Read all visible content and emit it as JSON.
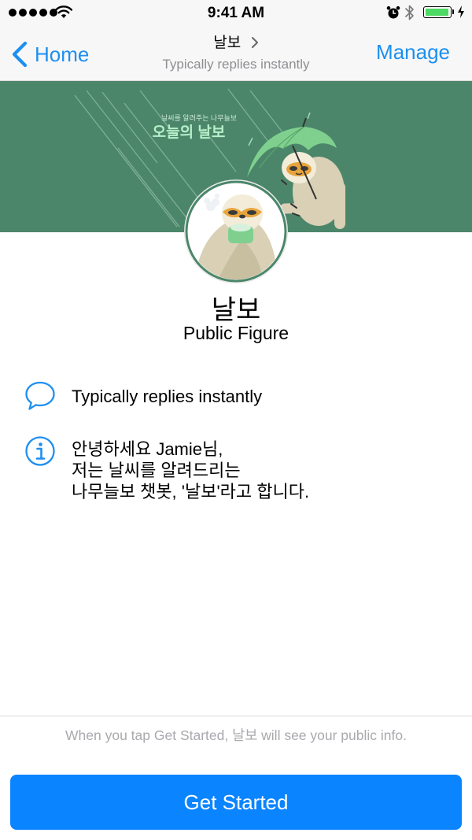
{
  "status_bar": {
    "time": "9:41 AM",
    "signal_icon": "signal-dots-icon",
    "wifi_icon": "wifi-icon",
    "alarm_icon": "alarm-clock-icon",
    "bluetooth_icon": "bluetooth-icon",
    "battery_icon": "battery-icon",
    "battery_level": 1.0,
    "charging_icon": "charging-bolt-icon"
  },
  "nav": {
    "back_label": "Home",
    "title": "날보",
    "subtitle": "Typically replies instantly",
    "manage_label": "Manage"
  },
  "banner": {
    "small_text": "날씨를 알려주는 나무늘보",
    "big_text": "오늘의 날보"
  },
  "profile": {
    "name": "날보",
    "category": "Public Figure"
  },
  "info": {
    "response_time": "Typically replies instantly",
    "about_lines": [
      "안녕하세요 Jamie님,",
      "저는 날씨를 알려드리는",
      "나무늘보 챗봇, '날보'라고 합니다."
    ]
  },
  "footer": {
    "disclaimer": "When you tap Get Started, 날보 will see your public info.",
    "button_label": "Get Started"
  },
  "colors": {
    "accent": "#1d8ff0",
    "button": "#0a84ff",
    "banner": "#4b866a",
    "battery": "#4cd964"
  }
}
